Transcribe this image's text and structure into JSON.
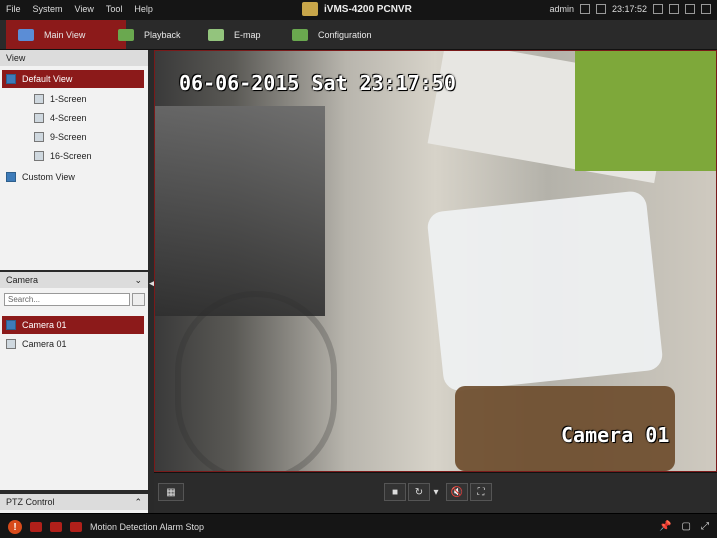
{
  "menubar": {
    "items": [
      "File",
      "System",
      "View",
      "Tool",
      "Help"
    ],
    "title": "iVMS-4200  PCNVR",
    "user": "admin",
    "time": "23:17:52"
  },
  "tabs": [
    {
      "label": "Main View",
      "active": true,
      "icon": "main-view-icon",
      "color": "#5b8dd6"
    },
    {
      "label": "Playback",
      "active": false,
      "icon": "playback-icon",
      "color": "#6aa84f"
    },
    {
      "label": "E-map",
      "active": false,
      "icon": "emap-icon",
      "color": "#93c47d"
    },
    {
      "label": "Configuration",
      "active": false,
      "icon": "configuration-icon",
      "color": "#6aa84f"
    }
  ],
  "view_panel": {
    "title": "View",
    "items": [
      {
        "label": "Default View",
        "selected": true
      },
      {
        "label": "1-Screen",
        "selected": false
      },
      {
        "label": "4-Screen",
        "selected": false
      },
      {
        "label": "9-Screen",
        "selected": false
      },
      {
        "label": "16-Screen",
        "selected": false
      },
      {
        "label": "Custom View",
        "selected": false
      }
    ]
  },
  "camera_panel": {
    "title": "Camera",
    "search_placeholder": "Search...",
    "items": [
      {
        "label": "Camera 01",
        "selected": true
      },
      {
        "label": "Camera 01",
        "selected": false
      }
    ]
  },
  "ptz_panel": {
    "title": "PTZ Control"
  },
  "video": {
    "timestamp": "06-06-2015 Sat 23:17:50",
    "camera_label": "Camera 01"
  },
  "status_bar": {
    "message": "Motion Detection Alarm Stop"
  },
  "colors": {
    "accent": "#8c1a1a",
    "bg_dark": "#151515"
  }
}
